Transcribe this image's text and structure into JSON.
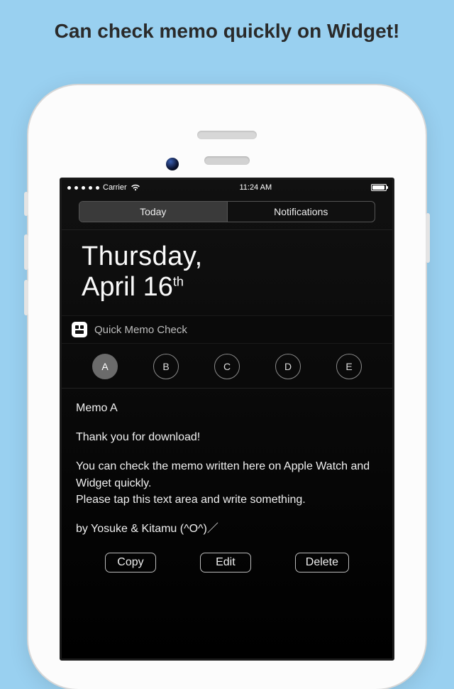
{
  "promo": {
    "heading": "Can check memo quickly on Widget!"
  },
  "statusbar": {
    "carrier": "Carrier",
    "time": "11:24 AM"
  },
  "tabs": {
    "today": "Today",
    "notifications": "Notifications"
  },
  "date": {
    "weekday": "Thursday,",
    "month_day": "April 16",
    "ordinal": "th"
  },
  "widget": {
    "title": "Quick Memo Check",
    "letters": [
      "A",
      "B",
      "C",
      "D",
      "E"
    ],
    "selected_index": 0
  },
  "memo": {
    "title": "Memo A",
    "p1": "Thank you for download!",
    "p2": "You can check the memo written here on Apple Watch and Widget quickly.\nPlease tap this text area and write something.",
    "signoff": "by Yosuke & Kitamu (^O^)／"
  },
  "actions": {
    "copy": "Copy",
    "edit": "Edit",
    "delete": "Delete"
  }
}
